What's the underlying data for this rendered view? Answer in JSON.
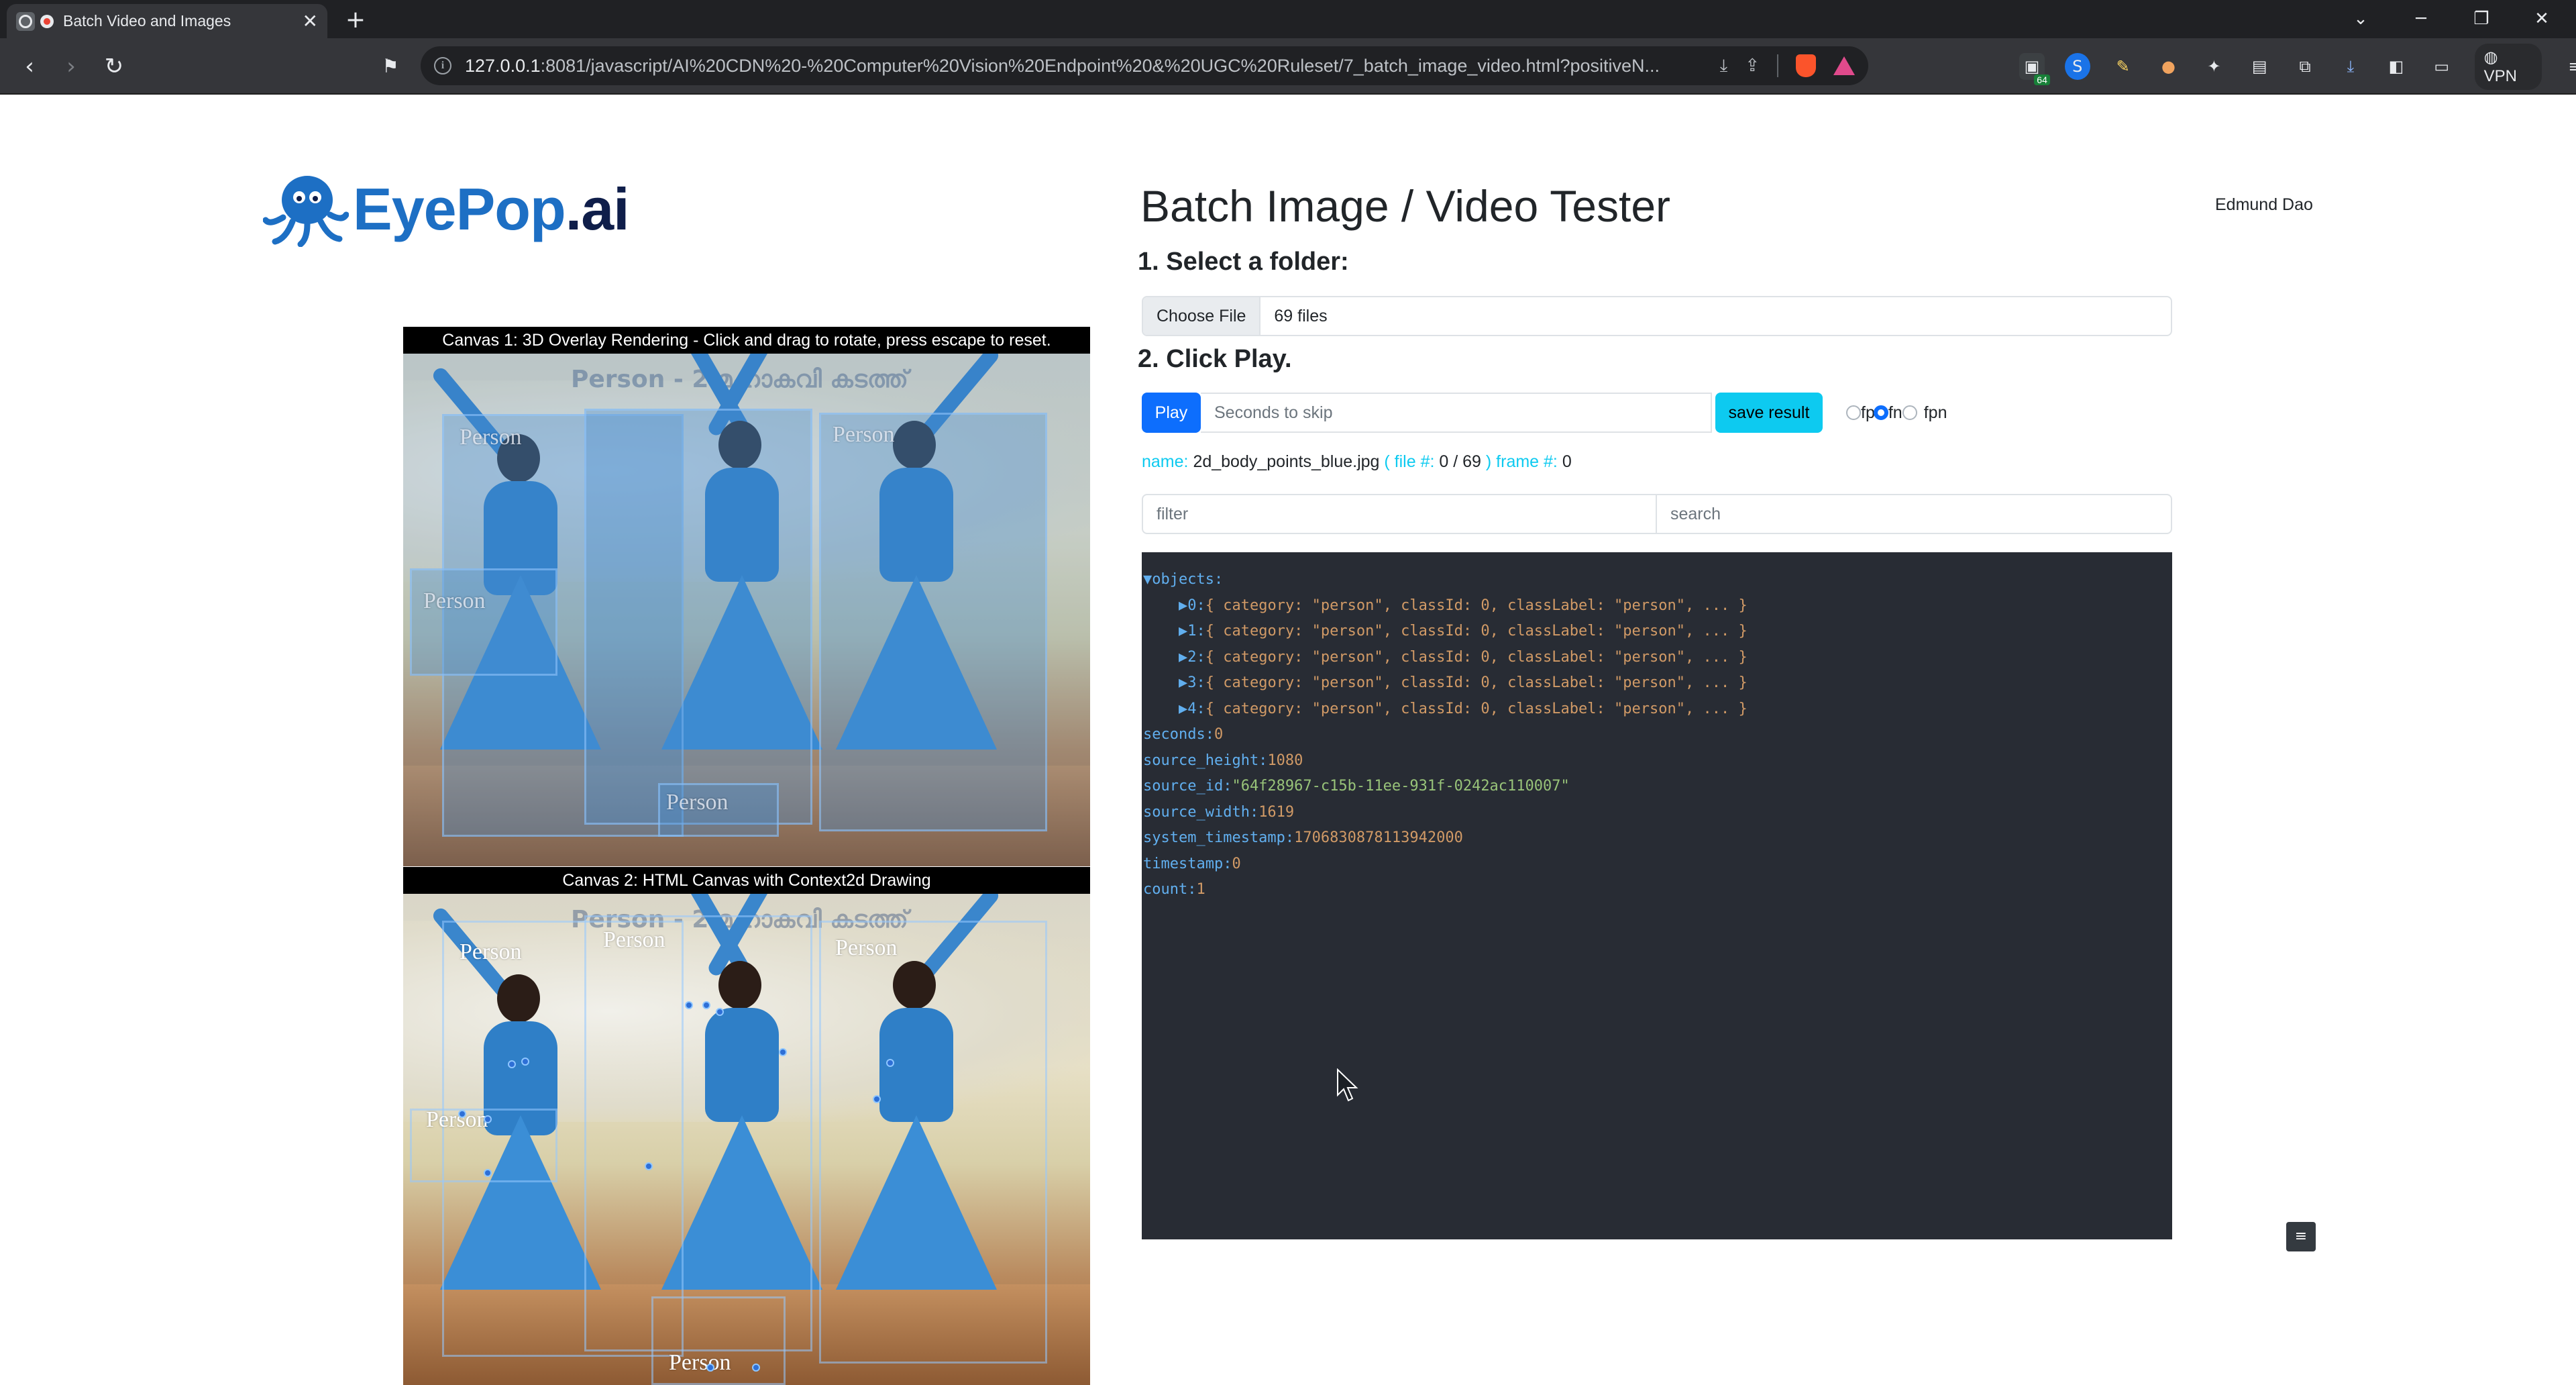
{
  "browser": {
    "tab_title": "Batch Video and Images",
    "tab_close": "✕",
    "new_tab": "+",
    "url_host": "127.0.0.1",
    "url_rest": ":8081/javascript/AI%20CDN%20-%20Computer%20Vision%20Endpoint%20&%20UGC%20Ruleset/7_batch_image_video.html?positiveN...",
    "ext_badge": "64",
    "vpn_label": "VPN"
  },
  "header": {
    "logo_part1": "EyePop",
    "logo_part2": ".ai",
    "title": "Batch Image / Video Tester",
    "user_name": "Edmund Dao"
  },
  "step1": {
    "heading": "1. Select a folder:",
    "choose_label": "Choose File",
    "file_count": "69 files"
  },
  "step2": {
    "heading": "2. Click Play.",
    "play_label": "Play",
    "seconds_placeholder": "Seconds to skip",
    "save_label": "save result",
    "radio_options": [
      "fp",
      "fn",
      "fpn"
    ],
    "radio_selected": "fn"
  },
  "meta": {
    "name_key": "name:",
    "name_value": "2d_body_points_blue.jpg",
    "file_key": "( file #:",
    "file_value": "0 / 69",
    "frame_key": ") frame #:",
    "frame_value": "0"
  },
  "filters": {
    "filter_placeholder": "filter",
    "search_placeholder": "search"
  },
  "json_view": {
    "objects_key": "▼objects:",
    "objects": [
      {
        "idx": "▶0:",
        "body": "{ category: \"person\", classId: 0, classLabel: \"person\", ... }"
      },
      {
        "idx": "▶1:",
        "body": "{ category: \"person\", classId: 0, classLabel: \"person\", ... }"
      },
      {
        "idx": "▶2:",
        "body": "{ category: \"person\", classId: 0, classLabel: \"person\", ... }"
      },
      {
        "idx": "▶3:",
        "body": "{ category: \"person\", classId: 0, classLabel: \"person\", ... }"
      },
      {
        "idx": "▶4:",
        "body": "{ category: \"person\", classId: 0, classLabel: \"person\", ... }"
      }
    ],
    "fields": [
      {
        "key": "seconds:",
        "value": "0",
        "type": "num"
      },
      {
        "key": "source_height:",
        "value": "1080",
        "type": "num"
      },
      {
        "key": "source_id:",
        "value": "\"64f28967-c15b-11ee-931f-0242ac110007\"",
        "type": "str"
      },
      {
        "key": "source_width:",
        "value": "1619",
        "type": "num"
      },
      {
        "key": "system_timestamp:",
        "value": "1706830878113942000",
        "type": "num"
      },
      {
        "key": "timestamp:",
        "value": "0",
        "type": "num"
      },
      {
        "key": "count:",
        "value": "1",
        "type": "num"
      }
    ]
  },
  "canvases": {
    "canvas1_caption": "Canvas 1: 3D Overlay Rendering - Click and drag to rotate, press escape to reset.",
    "canvas2_caption": "Canvas 2: HTML Canvas with Context2d Drawing",
    "person_label": "Person",
    "banner_text": "Person - 2 മഹാകവി കടത്ത്"
  },
  "misc": {
    "scroll_button": "≡"
  }
}
